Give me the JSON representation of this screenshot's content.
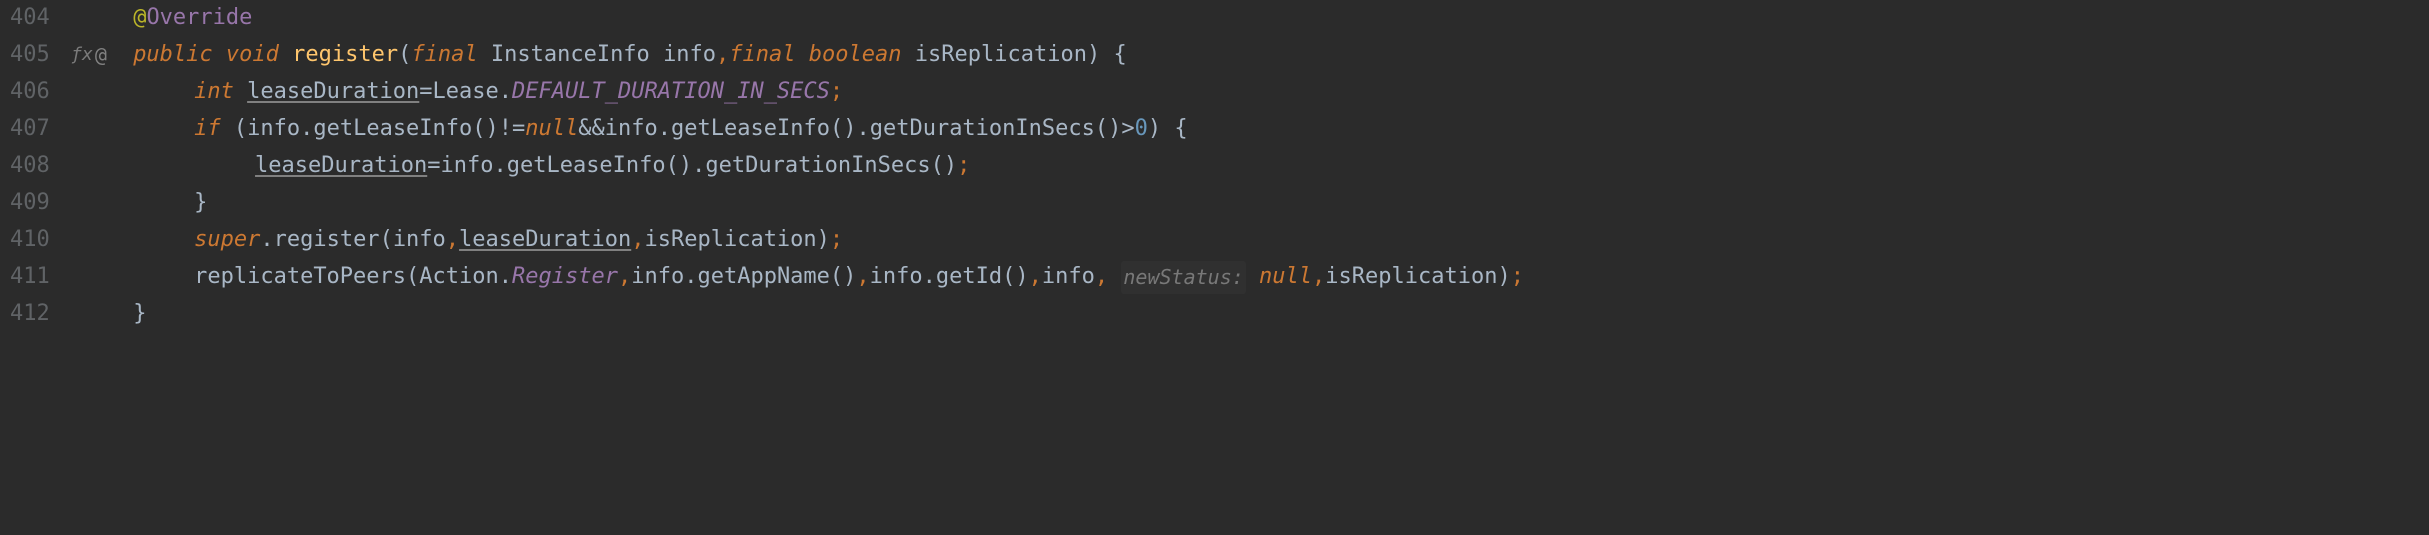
{
  "lines": {
    "404": "404",
    "405": "405",
    "406": "406",
    "407": "407",
    "408": "408",
    "409": "409",
    "410": "410",
    "411": "411",
    "412": "412"
  },
  "gutter": {
    "fx": "ƒx",
    "at": "@"
  },
  "code": {
    "at": "@",
    "override": "Override",
    "public": "public",
    "void": "void",
    "register_decl": "register",
    "final": "final",
    "instanceinfo": "InstanceInfo",
    "info": "info",
    "boolean": "boolean",
    "isreplication": "isReplication",
    "lbrace": "{",
    "rbrace": "}",
    "int": "int",
    "leaseduration": "leaseDuration",
    "eq": " = ",
    "lease": "Lease",
    "default_duration": "DEFAULT_DURATION_IN_SECS",
    "semi": ";",
    "if": "if",
    "getleaseinfo": "getLeaseInfo",
    "neq": " != ",
    "null": "null",
    "andand": " && ",
    "getdurationinsecs": "getDurationInSecs",
    "gt": " > ",
    "zero": "0",
    "super": "super",
    "register_call": "register",
    "replicatetopeers": "replicateToPeers",
    "action": "Action",
    "register_enum": "Register",
    "getappname": "getAppName",
    "getid": "getId",
    "hint_newstatus": "newStatus:",
    "lparen": "(",
    "rparen": ")",
    "dot": ".",
    "comma": ", "
  }
}
